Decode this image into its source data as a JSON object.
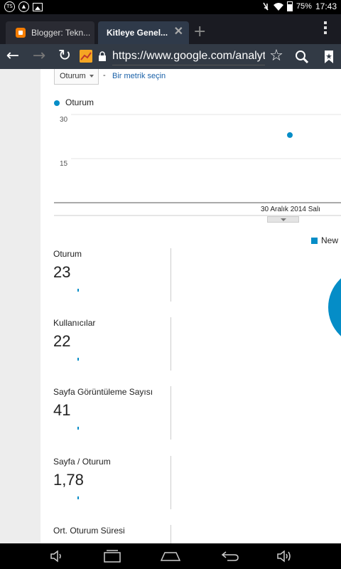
{
  "status_bar": {
    "left_icons": [
      "ts-app-icon",
      "navigation-app-icon",
      "image-icon"
    ],
    "ts_label": "TS",
    "battery_percent": "75%",
    "time": "17:43"
  },
  "tabs": [
    {
      "title": "Blogger: Tekn...",
      "icon": "blogger-icon",
      "active": false
    },
    {
      "title": "Kitleye Genel...",
      "active": true
    }
  ],
  "toolbar": {
    "url": "https://www.google.com/analytics",
    "icons": [
      "back-arrow-icon",
      "forward-arrow-icon",
      "reload-icon",
      "analytics-icon",
      "lock-icon",
      "star-icon",
      "search-icon",
      "bookmark-icon"
    ]
  },
  "controls": {
    "metric_select": "Oturum",
    "separator": "-",
    "add_metric_link": "Bir metrik seçin"
  },
  "chart_data": {
    "type": "scatter",
    "series": [
      {
        "name": "Oturum",
        "color": "#058dc7",
        "points": [
          {
            "x": "30 Aralık 2014 Salı",
            "y": 23
          }
        ]
      }
    ],
    "y_ticks": [
      "30",
      "15"
    ],
    "ylim": [
      0,
      30
    ],
    "x_label_shown": "30 Aralık 2014 Salı",
    "grid": true
  },
  "pie_legend": {
    "label": "New",
    "color": "#058dc7"
  },
  "metrics": [
    {
      "label": "Oturum",
      "value": "23"
    },
    {
      "label": "Kullanıcılar",
      "value": "22"
    },
    {
      "label": "Sayfa Görüntüleme Sayısı",
      "value": "41"
    },
    {
      "label": "Sayfa / Oturum",
      "value": "1,78"
    },
    {
      "label": "Ort. Oturum Süresi",
      "value": ""
    }
  ],
  "nav_bar": {
    "icons": [
      "volume-down-icon",
      "recent-apps-icon",
      "home-icon",
      "back-icon",
      "volume-up-icon"
    ]
  }
}
